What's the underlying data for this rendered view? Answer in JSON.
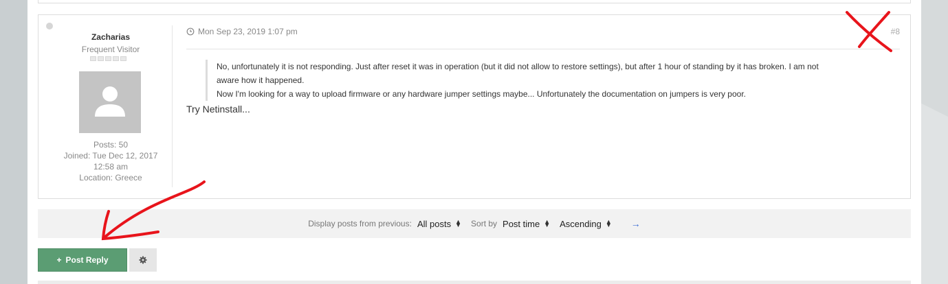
{
  "post": {
    "author": "Zacharias",
    "rank": "Frequent Visitor",
    "posts": "Posts: 50",
    "joined_line1": "Joined: Tue Dec 12, 2017",
    "joined_line2": "12:58 am",
    "location": "Location: Greece",
    "date": "Mon Sep 23, 2019 1:07 pm",
    "number": "#8",
    "quote_line1": "No, unfortunately it is not responding. Just after reset it was in operation (but it did not allow to restore settings), but after 1 hour of standing by it has broken. I am not",
    "quote_line2": "aware how it happened.",
    "quote_line3": "Now I'm looking for a way to upload firmware or any hardware jumper settings maybe... Unfortunately the documentation on jumpers is very poor.",
    "reply": "Try Netinstall..."
  },
  "toolbar": {
    "display_label": "Display posts from previous:",
    "display_value": "All posts",
    "sort_label": "Sort by",
    "sort_value": "Post time",
    "order_value": "Ascending"
  },
  "actions": {
    "post_reply_label": "Post Reply"
  },
  "icons": {
    "clock": "clock-icon",
    "gear": "gear-icon",
    "go": "arrow-right-icon",
    "plus": "plus-icon"
  },
  "colors": {
    "accent_green": "#5b9d73",
    "annotation_red": "#e8141b",
    "link_blue": "#3b6fd4"
  }
}
